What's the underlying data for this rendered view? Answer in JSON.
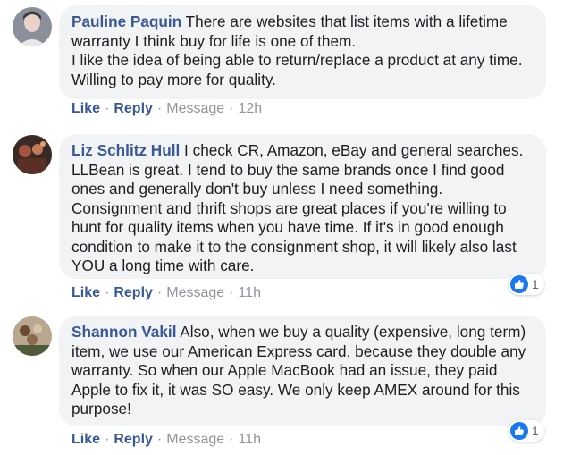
{
  "comments": [
    {
      "author": "Pauline Paquin",
      "text": " There are websites that list items with a lifetime warranty I think buy for life is one of them.\nI like the idea of being able to return/replace a product at any time. Willing to pay more for quality.",
      "actions": {
        "like": "Like",
        "reply": "Reply",
        "message": "Message",
        "time": "12h"
      }
    },
    {
      "author": "Liz Schlitz Hull",
      "text": " I check CR, Amazon, eBay and general searches. LLBean is great. I tend to buy the same brands once I find good ones and generally don't buy unless I need something. Consignment and thrift shops are great places if you're willing to hunt for quality items when you have time. If it's in good enough condition to make it to the consignment shop, it will likely also last YOU a long time with care.",
      "actions": {
        "like": "Like",
        "reply": "Reply",
        "message": "Message",
        "time": "11h"
      },
      "reaction_count": "1"
    },
    {
      "author": "Shannon Vakil",
      "text": " Also, when we buy a quality (expensive, long term) item, we use our American Express card, because they double any warranty. So when our Apple MacBook had an issue, they paid Apple to fix it, it was SO easy. We only keep AMEX around for this purpose!",
      "actions": {
        "like": "Like",
        "reply": "Reply",
        "message": "Message",
        "time": "11h"
      },
      "reaction_count": "1"
    }
  ],
  "separator": "·",
  "colors": {
    "name": "#385898",
    "muted": "#90949c",
    "bubble": "#f2f3f5",
    "like_badge": "#1877f2"
  }
}
